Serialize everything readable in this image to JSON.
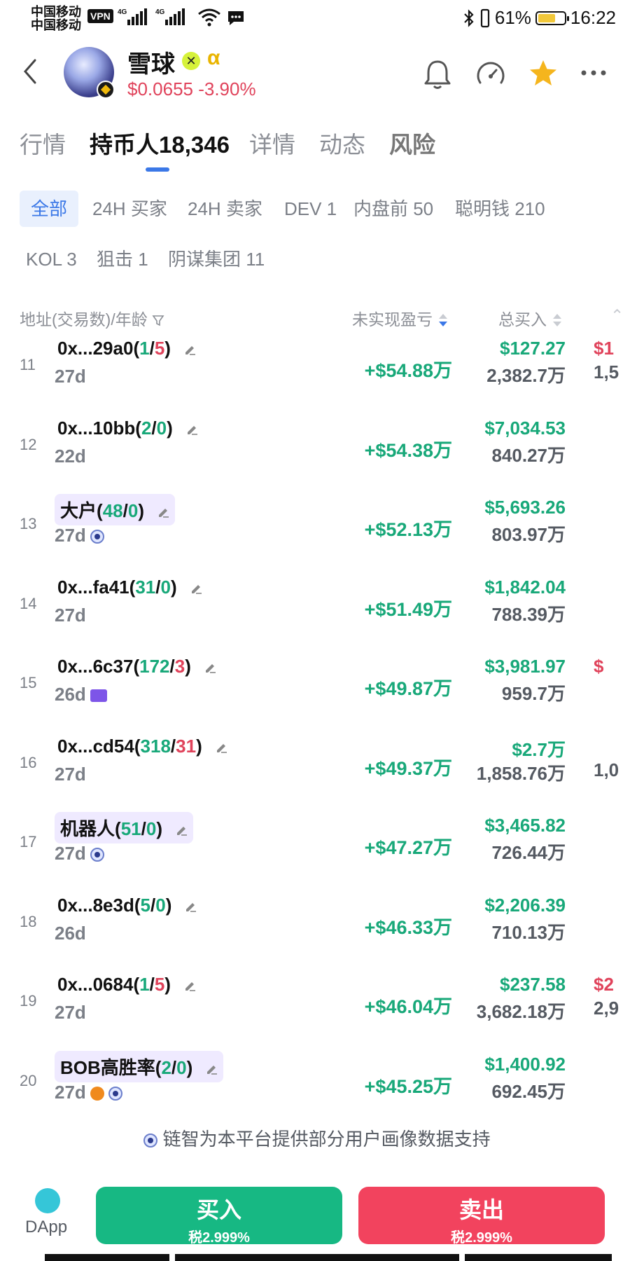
{
  "status_bar": {
    "carrier_line1": "中国移动",
    "carrier_line2": "中国移动",
    "vpn": "VPN",
    "network1": "4G",
    "network2": "4G",
    "battery": "61%",
    "time": "16:22"
  },
  "token": {
    "name": "雪球",
    "x_badge": "✕",
    "alpha": "α",
    "price": "$0.0655 -3.90%"
  },
  "tabs": [
    {
      "label": "行情"
    },
    {
      "label": "持币人18,346"
    },
    {
      "label": "详情"
    },
    {
      "label": "动态"
    },
    {
      "label": "风险"
    }
  ],
  "filters": [
    {
      "label": "全部"
    },
    {
      "label": "24H 买家"
    },
    {
      "label": "24H 卖家"
    },
    {
      "label": "DEV 1"
    },
    {
      "label": "内盘前 50"
    },
    {
      "label": "聪明钱 210"
    },
    {
      "label": "KOL 3"
    },
    {
      "label": "狙击 1"
    },
    {
      "label": "阴谋集团 11"
    }
  ],
  "columns": {
    "address": "地址(交易数)/年龄",
    "unrealized": "未实现盈亏",
    "total_buy": "总买入"
  },
  "rows": [
    {
      "rank": "11",
      "name": "0x...29a0",
      "buys": "1",
      "sells": "5",
      "age": "27d",
      "unrealized": "+$54.88万",
      "buy_amount": "$127.27",
      "buy_qty": "2,382.7万",
      "cut_a": "$1",
      "cut_b": "1,5"
    },
    {
      "rank": "12",
      "name": "0x...10bb",
      "buys": "2",
      "sells": "0",
      "age": "22d",
      "unrealized": "+$54.38万",
      "buy_amount": "$7,034.53",
      "buy_qty": "840.27万",
      "cut_a": "",
      "cut_b": ""
    },
    {
      "rank": "13",
      "name": "大户",
      "buys": "48",
      "sells": "0",
      "age": "27d",
      "unrealized": "+$52.13万",
      "buy_amount": "$5,693.26",
      "buy_qty": "803.97万",
      "cut_a": "",
      "cut_b": ""
    },
    {
      "rank": "14",
      "name": "0x...fa41",
      "buys": "31",
      "sells": "0",
      "age": "27d",
      "unrealized": "+$51.49万",
      "buy_amount": "$1,842.04",
      "buy_qty": "788.39万",
      "cut_a": "",
      "cut_b": ""
    },
    {
      "rank": "15",
      "name": "0x...6c37",
      "buys": "172",
      "sells": "3",
      "age": "26d",
      "unrealized": "+$49.87万",
      "buy_amount": "$3,981.97",
      "buy_qty": "959.7万",
      "cut_a": "$",
      "cut_b": ""
    },
    {
      "rank": "16",
      "name": "0x...cd54",
      "buys": "318",
      "sells": "31",
      "age": "27d",
      "unrealized": "+$49.37万",
      "buy_amount": "$2.7万",
      "buy_qty": "1,858.76万",
      "cut_a": "",
      "cut_b": "1,0"
    },
    {
      "rank": "17",
      "name": "机器人",
      "buys": "51",
      "sells": "0",
      "age": "27d",
      "unrealized": "+$47.27万",
      "buy_amount": "$3,465.82",
      "buy_qty": "726.44万",
      "cut_a": "",
      "cut_b": ""
    },
    {
      "rank": "18",
      "name": "0x...8e3d",
      "buys": "5",
      "sells": "0",
      "age": "26d",
      "unrealized": "+$46.33万",
      "buy_amount": "$2,206.39",
      "buy_qty": "710.13万",
      "cut_a": "",
      "cut_b": ""
    },
    {
      "rank": "19",
      "name": "0x...0684",
      "buys": "1",
      "sells": "5",
      "age": "27d",
      "unrealized": "+$46.04万",
      "buy_amount": "$237.58",
      "buy_qty": "3,682.18万",
      "cut_a": "$2",
      "cut_b": "2,9"
    },
    {
      "rank": "20",
      "name": "BOB高胜率",
      "buys": "2",
      "sells": "0",
      "age": "27d",
      "unrealized": "+$45.25万",
      "buy_amount": "$1,400.92",
      "buy_qty": "692.45万",
      "cut_a": "",
      "cut_b": ""
    }
  ],
  "footnote": "链智为本平台提供部分用户画像数据支持",
  "bottom": {
    "dapp": "DApp",
    "buy_label": "买入",
    "buy_tax": "税2.999%",
    "sell_label": "卖出",
    "sell_tax": "税2.999%"
  },
  "colors": {
    "green": "#18a879",
    "red": "#e0435b",
    "accent": "#3b78e7",
    "buy_button": "#17b883",
    "sell_button": "#f2435e"
  }
}
